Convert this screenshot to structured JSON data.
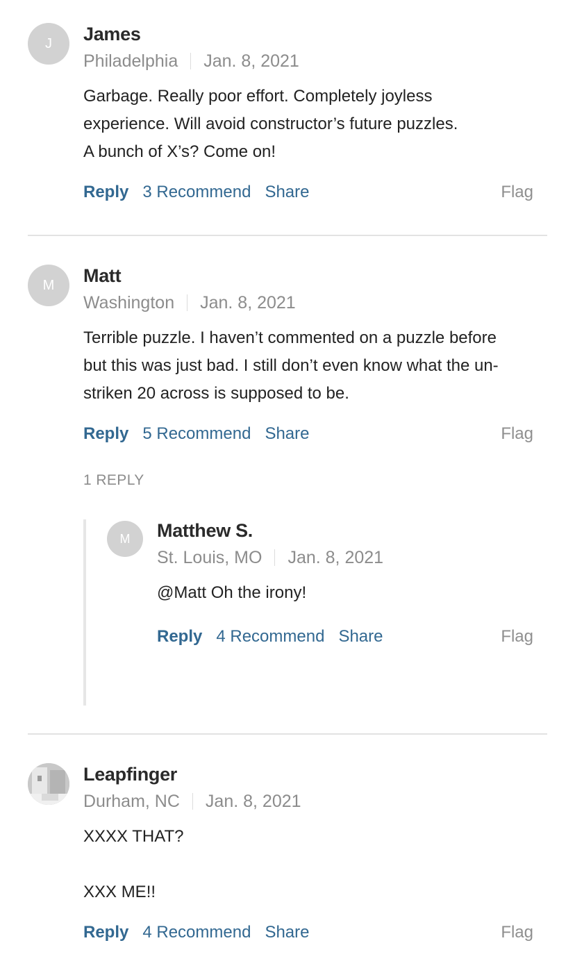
{
  "comments": [
    {
      "avatar_letter": "J",
      "name": "James",
      "location": "Philadelphia",
      "date": "Jan. 8, 2021",
      "lines": [
        "Garbage. Really poor effort. Completely joyless",
        "experience. Will avoid constructor’s future puzzles.",
        "A bunch of X’s? Come on!"
      ],
      "reply_label": "Reply",
      "recommend_label": "3 Recommend",
      "share_label": "Share",
      "flag_label": "Flag"
    },
    {
      "avatar_letter": "M",
      "name": "Matt",
      "location": "Washington",
      "date": "Jan. 8, 2021",
      "lines": [
        "Terrible puzzle. I haven’t commented on a puzzle before",
        "but this was just bad. I still don’t even know what the un-",
        "striken 20 across is supposed to be."
      ],
      "reply_label": "Reply",
      "recommend_label": "5 Recommend",
      "share_label": "Share",
      "flag_label": "Flag",
      "replies_count_label": "1 REPLY",
      "replies": [
        {
          "avatar_letter": "M",
          "name": "Matthew S.",
          "location": "St. Louis, MO",
          "date": "Jan. 8, 2021",
          "lines": [
            "@Matt Oh the irony!"
          ],
          "reply_label": "Reply",
          "recommend_label": "4 Recommend",
          "share_label": "Share",
          "flag_label": "Flag"
        }
      ]
    },
    {
      "avatar_icon": "user-photo-icon",
      "name": "Leapfinger",
      "location": "Durham, NC",
      "date": "Jan. 8, 2021",
      "lines": [
        "XXXX THAT?",
        "",
        "XXX ME!!"
      ],
      "reply_label": "Reply",
      "recommend_label": "4 Recommend",
      "share_label": "Share",
      "flag_label": "Flag"
    }
  ],
  "colors": {
    "link": "#326891",
    "meta": "#8c8c8c",
    "avatar": "#d2d2d2",
    "divider": "#e2e2e2"
  }
}
